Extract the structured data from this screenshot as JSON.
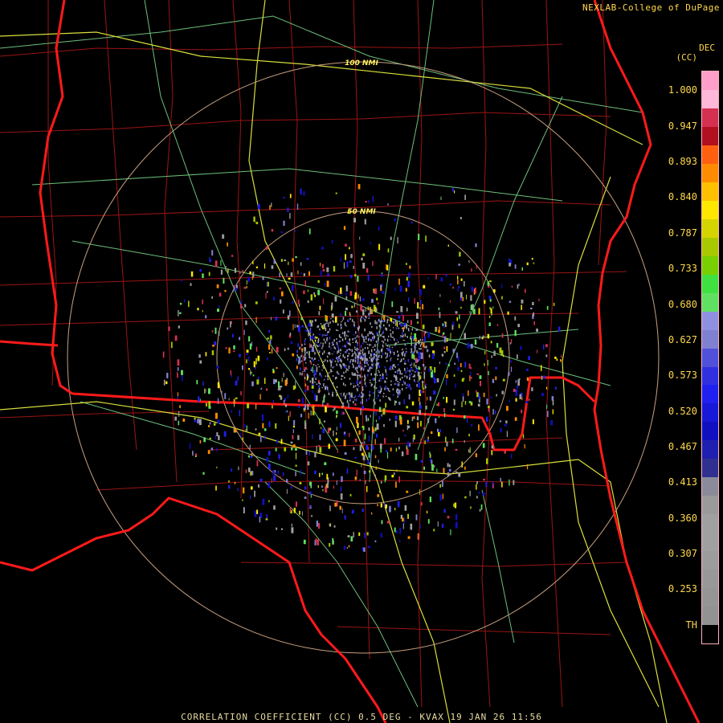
{
  "credit": "NEXLAB-College of DuPage",
  "product_code": "DEC",
  "unit": "(CC)",
  "footer": "CORRELATION COEFFICIENT (CC) 0.5 DEG - KVAX 19 JAN 26 11:56",
  "range_rings": [
    {
      "label": "50 NMI"
    },
    {
      "label": "100 NMI"
    }
  ],
  "scale": {
    "ticks": [
      "1.000",
      "0.947",
      "0.893",
      "0.840",
      "0.787",
      "0.733",
      "0.680",
      "0.627",
      "0.573",
      "0.520",
      "0.467",
      "0.413",
      "0.360",
      "0.307",
      "0.253",
      "TH"
    ],
    "colors": [
      "#ff9ec8",
      "#ffb8d8",
      "#d43050",
      "#b01020",
      "#ff6010",
      "#ff8c00",
      "#ffc000",
      "#ffe800",
      "#d4d400",
      "#a8c800",
      "#78d000",
      "#40e040",
      "#60e060",
      "#9090e0",
      "#8080d0",
      "#5050d8",
      "#3030e0",
      "#2020f0",
      "#1818d8",
      "#1010c0",
      "#2020b0",
      "#303090",
      "#8a8a9a",
      "#9a9a9a",
      "#a0a0a0",
      "#a0a0a0",
      "#9c9c9c",
      "#989898",
      "#959595",
      "#929292",
      "#000000"
    ]
  },
  "colors": {
    "state_lines": "#ff1a1a",
    "county_lines": "#a01818",
    "highways": "#d8e040",
    "roads": "#70c080",
    "rings": "#c8a080",
    "text": "#ffd84a"
  }
}
